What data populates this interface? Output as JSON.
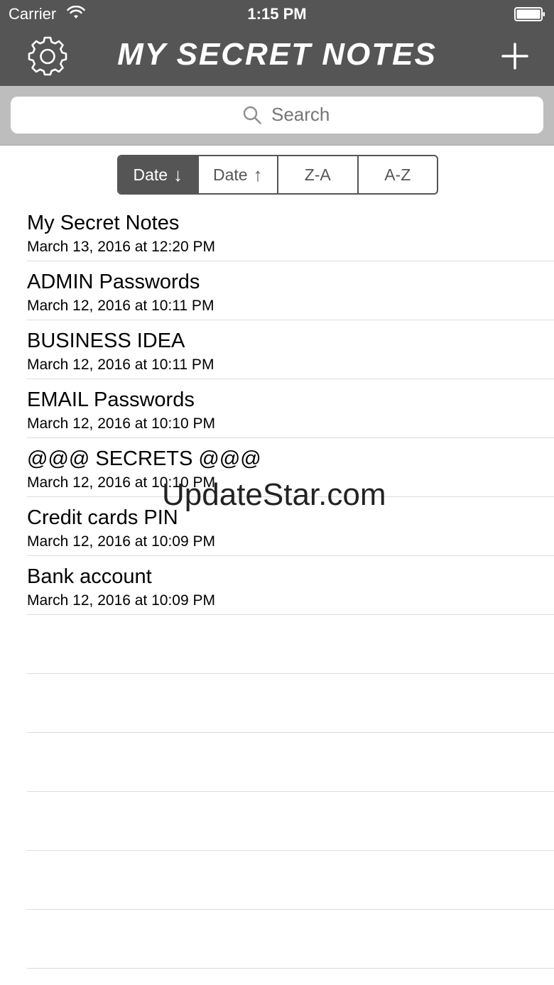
{
  "status": {
    "carrier": "Carrier",
    "time": "1:15 PM"
  },
  "nav": {
    "title": "MY SECRET NOTES",
    "settings_icon": "gear-icon",
    "add_icon": "plus-icon"
  },
  "search": {
    "placeholder": "Search"
  },
  "sort": {
    "options": [
      {
        "label": "Date",
        "arrow": "↓",
        "active": true
      },
      {
        "label": "Date",
        "arrow": "↑",
        "active": false
      },
      {
        "label": "Z-A",
        "arrow": "",
        "active": false
      },
      {
        "label": "A-Z",
        "arrow": "",
        "active": false
      }
    ]
  },
  "notes": [
    {
      "title": "My Secret Notes",
      "date": "March 13, 2016 at 12:20 PM"
    },
    {
      "title": "ADMIN Passwords",
      "date": "March 12, 2016 at 10:11 PM"
    },
    {
      "title": "BUSINESS IDEA",
      "date": "March 12, 2016 at 10:11 PM"
    },
    {
      "title": "EMAIL Passwords",
      "date": "March 12, 2016 at 10:10 PM"
    },
    {
      "title": "@@@ SECRETS @@@",
      "date": "March 12, 2016 at 10:10 PM"
    },
    {
      "title": "Credit cards PIN",
      "date": "March 12, 2016 at 10:09 PM"
    },
    {
      "title": "Bank account",
      "date": "March 12, 2016 at 10:09 PM"
    }
  ],
  "watermark": "UpdateStar.com",
  "colors": {
    "bar": "#555555",
    "search_bg": "#bdbdbd",
    "separator": "#dcdcdc"
  }
}
